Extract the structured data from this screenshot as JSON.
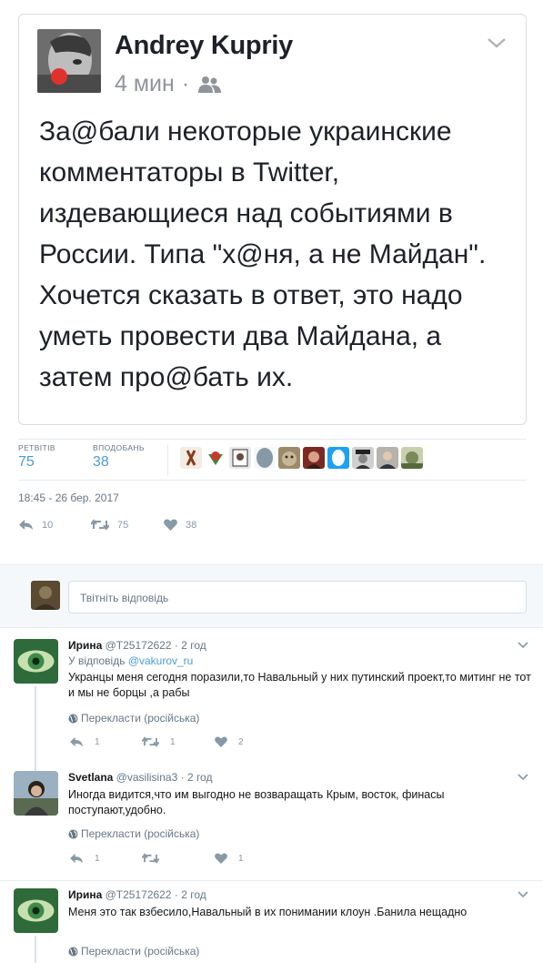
{
  "fb_post": {
    "author": "Andrey Kupriy",
    "time": "4 мин",
    "text": "За@бали некоторые украинские комментаторы в Twitter, издевающиеся над событиями в России. Типа \"х@ня, а не Майдан\". Хочется сказать в ответ, это надо уметь провести два Майдана, а затем про@бать их."
  },
  "stats": {
    "retweets_label": "РЕТВІТІВ",
    "retweets": "75",
    "likes_label": "ВПОДОБАНЬ",
    "likes": "38"
  },
  "timestamp": "18:45 - 26 бер. 2017",
  "actions": {
    "replies": "10",
    "retweets": "75",
    "likes": "38"
  },
  "reply_box": {
    "placeholder": "Твітніть відповідь"
  },
  "replies": [
    {
      "name": "Ирина",
      "handle": "@T25172622",
      "time": "2 год",
      "reply_to_prefix": "У відповідь",
      "reply_to_handle": "@vakurov_ru",
      "text": "Укранцы   меня сегодня поразили,то Навальный  у них путинский  проект,то митинг  не  тот  и мы не борцы ,а  рабы",
      "translate": "Перекласти (російська)",
      "replies": "1",
      "retweets": "1",
      "likes": "2"
    },
    {
      "name": "Svetlana",
      "handle": "@vasilisina3",
      "time": "2 год",
      "text": "Иногда видится,что им выгодно не возваращать Крым, восток, финасы поступают,удобно.",
      "translate": "Перекласти (російська)",
      "replies": "1",
      "retweets": "",
      "likes": "1"
    },
    {
      "name": "Ирина",
      "handle": "@T25172622",
      "time": "2 год",
      "text": "Меня это так взбесило,Навальный   в  их  понимании  клоун .Банила нещадно",
      "translate": "Перекласти (російська)"
    }
  ],
  "colors": {
    "link": "#4c9bd6",
    "muted": "#657786",
    "icon": "#8899a6",
    "text": "#14171a"
  }
}
